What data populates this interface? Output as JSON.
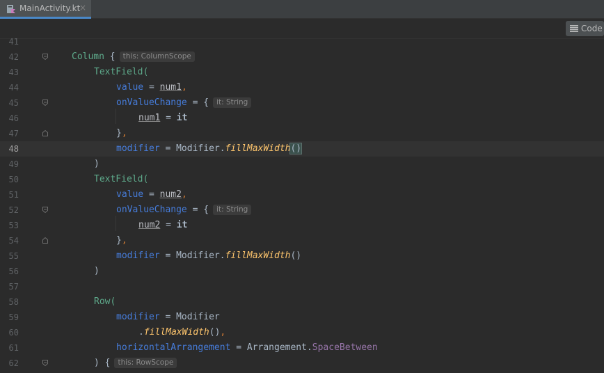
{
  "tab": {
    "label": "MainActivity.kt",
    "close": "×"
  },
  "toolbar": {
    "mode_label": "Code"
  },
  "editor": {
    "current_line": "48",
    "lines": [
      {
        "n": "41"
      },
      {
        "n": "42"
      },
      {
        "n": "43"
      },
      {
        "n": "44"
      },
      {
        "n": "45"
      },
      {
        "n": "46"
      },
      {
        "n": "47"
      },
      {
        "n": "48"
      },
      {
        "n": "49"
      },
      {
        "n": "50"
      },
      {
        "n": "51"
      },
      {
        "n": "52"
      },
      {
        "n": "53"
      },
      {
        "n": "54"
      },
      {
        "n": "55"
      },
      {
        "n": "56"
      },
      {
        "n": "57"
      },
      {
        "n": "58"
      },
      {
        "n": "59"
      },
      {
        "n": "60"
      },
      {
        "n": "61"
      },
      {
        "n": "62"
      }
    ],
    "tokens": {
      "column": "Column",
      "textfield": "TextField(",
      "value": "value",
      "eq": " = ",
      "num1": "num1",
      "num2": "num2",
      "comma": ",",
      "onvaluechange": "onValueChange",
      "brace_open": " {",
      "it": "it",
      "close_brace": "}",
      "modifier_kw": "modifier",
      "modifier_obj": "Modifier",
      "dot": ".",
      "fillmaxwidth": "fillMaxWidth",
      "parens": "()",
      "close_paren": ")",
      "row": "Row(",
      "horizontal": "horizontalArrangement",
      "arrangement": "Arrangement",
      "spacebetween": "SpaceBetween",
      "close_paren_brace": ") {"
    },
    "hints": {
      "column_scope": "this: ColumnScope",
      "it_string": "it: String",
      "row_scope": "this: RowScope"
    }
  }
}
